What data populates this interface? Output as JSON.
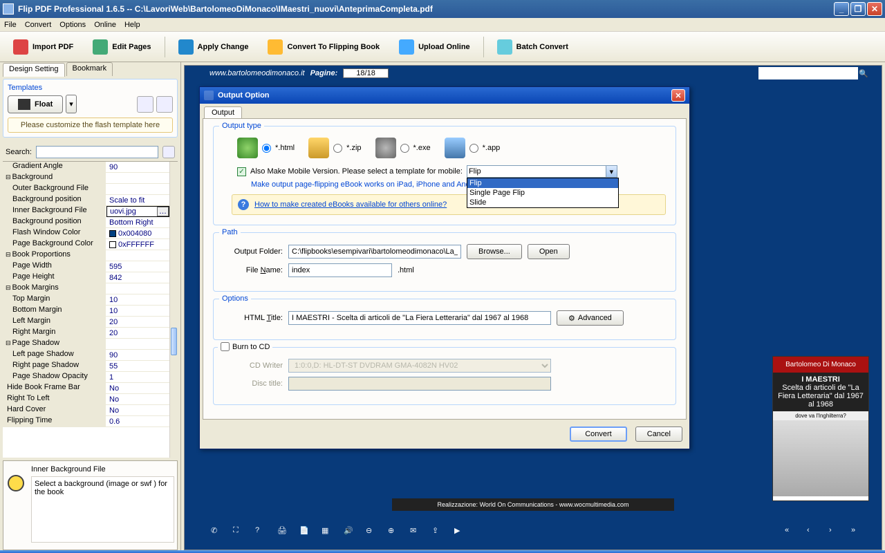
{
  "window": {
    "title": "Flip PDF Professional 1.6.5  -- C:\\LavoriWeb\\BartolomeoDiMonaco\\IMaestri_nuovi\\AnteprimaCompleta.pdf"
  },
  "menu": {
    "file": "File",
    "convert": "Convert",
    "options": "Options",
    "online": "Online",
    "help": "Help"
  },
  "toolbar": {
    "import": "Import PDF",
    "edit": "Edit Pages",
    "apply": "Apply Change",
    "convert": "Convert To Flipping Book",
    "upload": "Upload Online",
    "batch": "Batch Convert"
  },
  "tabs": {
    "design": "Design Setting",
    "bookmark": "Bookmark"
  },
  "templates": {
    "title": "Templates",
    "float": "Float",
    "note": "Please customize the flash template here"
  },
  "search": {
    "label": "Search:"
  },
  "props": {
    "gradient_angle_k": "Gradient Angle",
    "gradient_angle_v": "90",
    "background_k": "Background",
    "outer_bg_file_k": "Outer Background File",
    "outer_bg_file_v": "",
    "bg_pos1_k": "Background position",
    "bg_pos1_v": "Scale to fit",
    "inner_bg_file_k": "Inner Background File",
    "inner_bg_file_v": "uovi.jpg",
    "bg_pos2_k": "Background position",
    "bg_pos2_v": "Bottom Right",
    "flash_win_color_k": "Flash Window Color",
    "flash_win_color_v": "0x004080",
    "page_bg_color_k": "Page Background Color",
    "page_bg_color_v": "0xFFFFFF",
    "book_prop_k": "Book Proportions",
    "page_w_k": "Page Width",
    "page_w_v": "595",
    "page_h_k": "Page Height",
    "page_h_v": "842",
    "book_marg_k": "Book Margins",
    "top_m_k": "Top Margin",
    "top_m_v": "10",
    "bot_m_k": "Bottom Margin",
    "bot_m_v": "10",
    "left_m_k": "Left Margin",
    "left_m_v": "20",
    "right_m_k": "Right Margin",
    "right_m_v": "20",
    "page_shadow_k": "Page Shadow",
    "left_sh_k": "Left page Shadow",
    "left_sh_v": "90",
    "right_sh_k": "Right page Shadow",
    "right_sh_v": "55",
    "sh_op_k": "Page Shadow Opacity",
    "sh_op_v": "1",
    "hide_frame_k": "Hide Book Frame Bar",
    "hide_frame_v": "No",
    "rtl_k": "Right To Left",
    "rtl_v": "No",
    "hard_k": "Hard Cover",
    "hard_v": "No",
    "flip_time_k": "Flipping Time",
    "flip_time_v": "0.6"
  },
  "desc": {
    "title": "Inner Background File",
    "body": "Select a background (image or swf ) for the book"
  },
  "preview": {
    "url": "www.bartolomeodimonaco.it",
    "pages_label": "Pagine:",
    "pages": "18/18",
    "book_author": "Bartolomeo Di Monaco",
    "book_title": "I MAESTRI",
    "book_sub": "Scelta di articoli de \"La Fiera Letteraria\" dal 1967 al 1968",
    "book_line": "dove va l'Inghilterra?",
    "footer": "Realizzazione: World On Communications - www.wocmultimedia.com"
  },
  "dialog": {
    "title": "Output Option",
    "tab": "Output",
    "fs_output": "Output type",
    "r_html": "*.html",
    "r_zip": "*.zip",
    "r_exe": "*.exe",
    "r_app": "*.app",
    "mobile_chk": "Also Make Mobile Version. Please select a template for mobile:",
    "mobile_val": "Flip",
    "mobile_opts": {
      "o1": "Flip",
      "o2": "Single Page Flip",
      "o3": "Slide"
    },
    "mobile_note": "Make output page-flipping eBook works on iPad, iPhone and Android",
    "howto": "How to make created eBooks available for others online?",
    "fs_path": "Path",
    "out_folder_l": "Output Folder:",
    "out_folder_v": "C:\\flipbooks\\esempivari\\bartolomeodimonaco\\La_Fi",
    "browse": "Browse...",
    "open": "Open",
    "file_name_l": "File Name:",
    "file_name_v": "index",
    "file_ext": ".html",
    "fs_options": "Options",
    "html_title_l": "HTML Title:",
    "html_title_v": "I MAESTRI - Scelta di articoli de \"La Fiera Letteraria\" dal 1967 al 1968",
    "advanced": "Advanced",
    "burn_l": "Burn to CD",
    "cd_writer_l": "CD Writer",
    "cd_writer_v": "1:0:0,D: HL-DT-ST DVDRAM GMA-4082N HV02",
    "disc_title_l": "Disc title:",
    "convert": "Convert",
    "cancel": "Cancel"
  }
}
